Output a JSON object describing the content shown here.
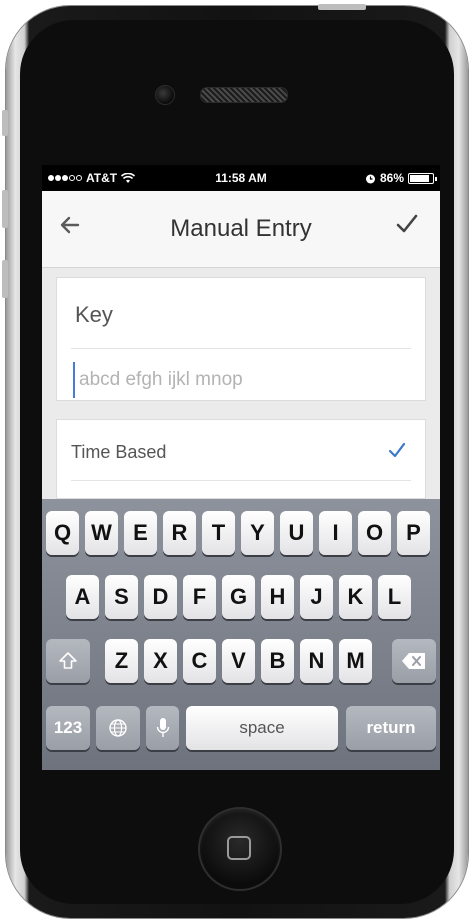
{
  "status_bar": {
    "carrier": "AT&T",
    "wifi_icon": "wifi-icon",
    "time": "11:58 AM",
    "alarm_icon": "alarm-icon",
    "battery_percent": "86%",
    "battery_level": 0.86
  },
  "nav": {
    "back_icon": "back-arrow-icon",
    "title": "Manual Entry",
    "confirm_icon": "check-icon"
  },
  "form": {
    "key_label": "Key",
    "key_value": "",
    "key_placeholder": "abcd efgh ijkl mnop",
    "type_label": "Time Based",
    "type_selected": true,
    "accent_color": "#3a78c9"
  },
  "keyboard": {
    "row1": [
      "Q",
      "W",
      "E",
      "R",
      "T",
      "Y",
      "U",
      "I",
      "O",
      "P"
    ],
    "row2": [
      "A",
      "S",
      "D",
      "F",
      "G",
      "H",
      "J",
      "K",
      "L"
    ],
    "row3": [
      "Z",
      "X",
      "C",
      "V",
      "B",
      "N",
      "M"
    ],
    "shift_icon": "shift-icon",
    "delete_icon": "delete-icon",
    "numbers_label": "123",
    "globe_icon": "globe-icon",
    "mic_icon": "microphone-icon",
    "space_label": "space",
    "return_label": "return"
  }
}
